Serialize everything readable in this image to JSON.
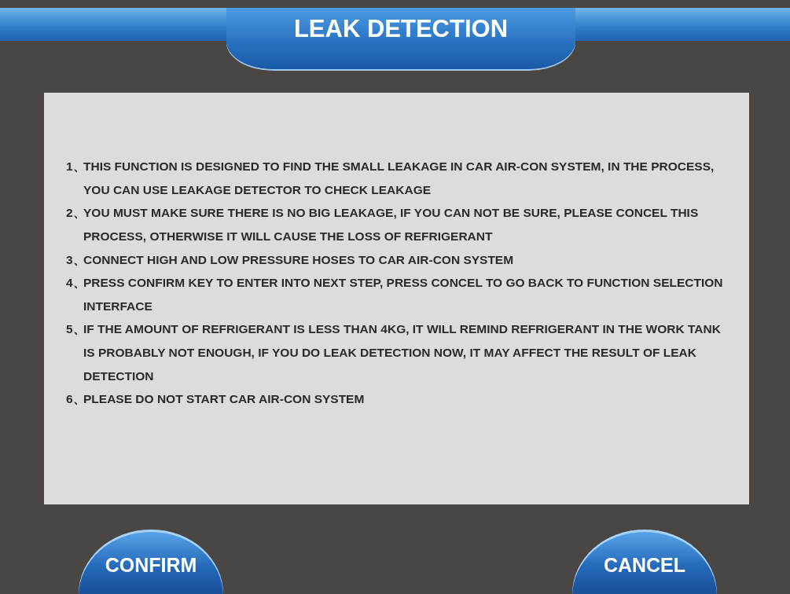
{
  "header": {
    "title": "LEAK DETECTION"
  },
  "instructions": [
    {
      "number": "1、",
      "text": "THIS FUNCTION IS DESIGNED TO FIND THE SMALL LEAKAGE IN CAR AIR-CON SYSTEM, IN THE PROCESS, YOU CAN USE LEAKAGE DETECTOR TO CHECK LEAKAGE"
    },
    {
      "number": "2、",
      "text": "YOU MUST MAKE SURE THERE IS NO BIG LEAKAGE, IF YOU CAN NOT BE SURE, PLEASE CONCEL THIS PROCESS, OTHERWISE IT WILL CAUSE THE LOSS OF REFRIGERANT"
    },
    {
      "number": "3、",
      "text": "CONNECT HIGH AND LOW PRESSURE HOSES TO CAR AIR-CON SYSTEM"
    },
    {
      "number": "4、",
      "text": "PRESS CONFIRM KEY TO ENTER INTO NEXT STEP, PRESS CONCEL TO GO BACK TO FUNCTION SELECTION INTERFACE"
    },
    {
      "number": "5、",
      "text": "IF THE AMOUNT OF REFRIGERANT IS LESS THAN 4KG, IT WILL REMIND REFRIGERANT IN THE WORK TANK IS PROBABLY NOT ENOUGH, IF YOU DO LEAK DETECTION NOW, IT MAY AFFECT THE RESULT OF LEAK DETECTION"
    },
    {
      "number": "6、",
      "text": "PLEASE DO NOT START CAR AIR-CON SYSTEM"
    }
  ],
  "buttons": [
    {
      "label": "CONFIRM"
    },
    {
      "label": "CANCEL"
    }
  ]
}
